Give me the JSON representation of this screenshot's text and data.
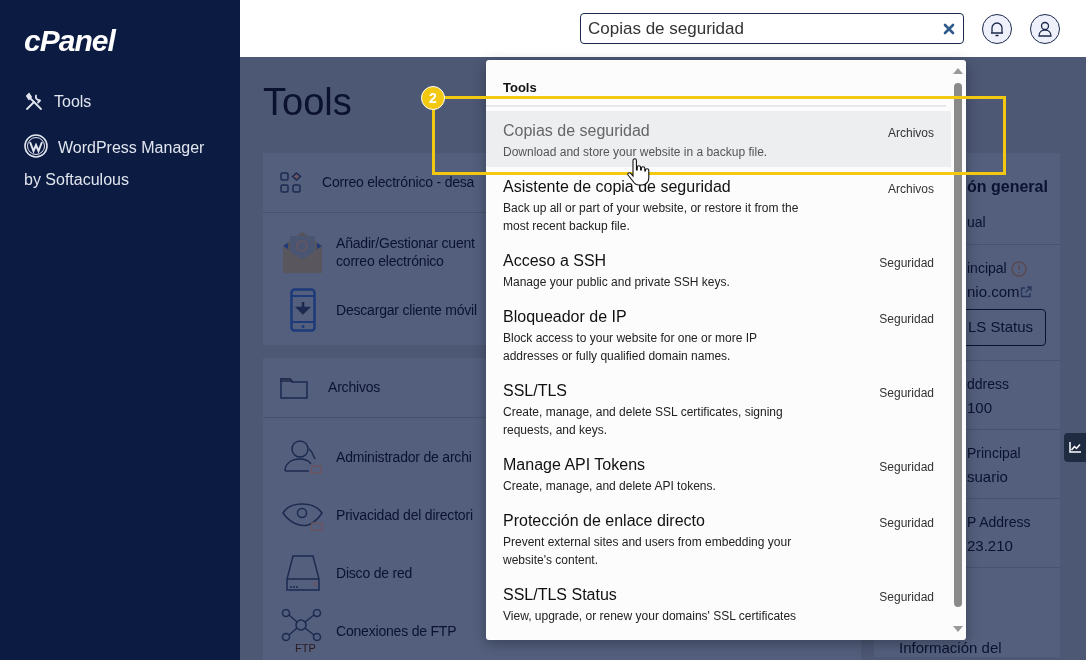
{
  "sidebar": {
    "logo": "cPanel",
    "items": [
      {
        "label": "Tools"
      },
      {
        "label": "WordPress Manager by Softaculous"
      }
    ]
  },
  "search": {
    "value": "Copias de seguridad"
  },
  "page_title": "Tools",
  "cards": [
    {
      "header": "Correo electrónico - desa",
      "items": [
        {
          "label": "Añadir/Gestionar cuent\ncorreo electrónico"
        },
        {
          "label": "Descargar cliente móvil"
        }
      ]
    },
    {
      "header": "Archivos",
      "items": [
        {
          "label": "Administrador de archi"
        },
        {
          "label": "Privacidad del directori"
        },
        {
          "label": "Disco de red"
        },
        {
          "label": "Conexiones de FTP",
          "icon_text": "FTP"
        }
      ]
    }
  ],
  "overview": {
    "title": "ón general",
    "sections": [
      {
        "lines": [
          {
            "kind": "text",
            "text": "ual"
          }
        ]
      },
      {
        "lines": [
          {
            "kind": "label",
            "text": "incipal",
            "warning": true
          },
          {
            "kind": "link",
            "text": "nio.com"
          },
          {
            "kind": "button",
            "text": "LS Status"
          }
        ]
      },
      {
        "lines": [
          {
            "kind": "label",
            "text": "ddress"
          },
          {
            "kind": "value",
            "text": "100"
          }
        ]
      },
      {
        "lines": [
          {
            "kind": "label",
            "text": "Principal"
          },
          {
            "kind": "value",
            "text": "suario"
          }
        ]
      },
      {
        "lines": [
          {
            "kind": "label",
            "text": "P Address"
          },
          {
            "kind": "value",
            "text": "23.210"
          }
        ]
      }
    ],
    "footer": "Información del"
  },
  "dropdown": {
    "heading": "Tools",
    "results": [
      {
        "title": "Copias de seguridad",
        "description": "Download and store your website in a backup file.",
        "category": "Archivos",
        "selected": true
      },
      {
        "title": "Asistente de copia de seguridad",
        "description": "Back up all or part of your website, or restore it from the most recent backup file.",
        "category": "Archivos",
        "selected": false
      },
      {
        "title": "Acceso a SSH",
        "description": "Manage your public and private SSH keys.",
        "category": "Seguridad",
        "selected": false
      },
      {
        "title": "Bloqueador de IP",
        "description": "Block access to your website for one or more IP addresses or fully qualified domain names.",
        "category": "Seguridad",
        "selected": false
      },
      {
        "title": "SSL/TLS",
        "description": "Create, manage, and delete SSL certificates, signing requests, and keys.",
        "category": "Seguridad",
        "selected": false
      },
      {
        "title": "Manage API Tokens",
        "description": "Create, manage, and delete API tokens.",
        "category": "Seguridad",
        "selected": false
      },
      {
        "title": "Protección de enlace directo",
        "description": "Prevent external sites and users from embedding your website's content.",
        "category": "Seguridad",
        "selected": false
      },
      {
        "title": "SSL/TLS Status",
        "description": "View, upgrade, or renew your domains' SSL certificates",
        "category": "Seguridad",
        "selected": false
      }
    ]
  },
  "annotation": {
    "step": "2"
  }
}
